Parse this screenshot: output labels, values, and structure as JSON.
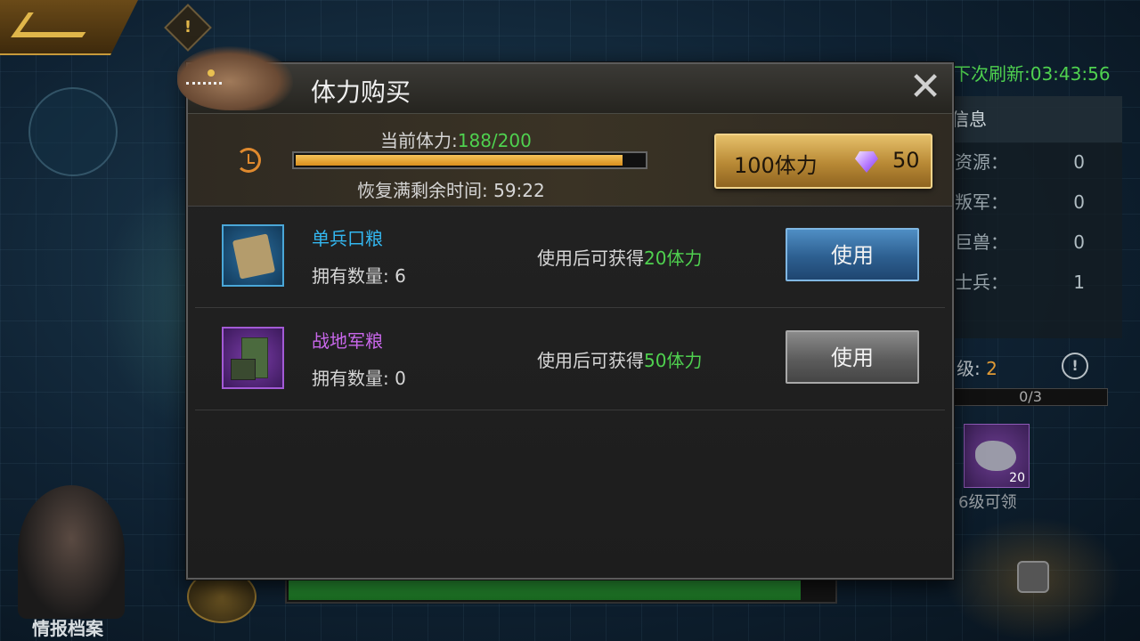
{
  "background": {
    "refresh_timer": "下次刷新:03:43:56",
    "panel_head": "信息",
    "rows": [
      {
        "label": "资源：",
        "value": "0"
      },
      {
        "label": "叛军：",
        "value": "0"
      },
      {
        "label": "巨兽：",
        "value": "0"
      },
      {
        "label": "士兵：",
        "value": "1"
      }
    ],
    "level_label": "级:",
    "level_value": "2",
    "progress": "0/3",
    "reward_count": "20",
    "reward_label": "6级可领",
    "portrait_label": "情报档案",
    "bottom_progress_fraction": 0.94
  },
  "dialog": {
    "title": "体力购买",
    "close_icon": "close-icon",
    "stamina": {
      "current_label": "当前体力:",
      "current_value": "188/200",
      "bar_fraction": 0.94,
      "recover_text": "恢复满剩余时间: 59:22"
    },
    "buy": {
      "label": "100体力",
      "cost": "50",
      "currency_icon": "diamond-icon"
    },
    "items": [
      {
        "name": "单兵口粮",
        "rarity_color": "#33b7f0",
        "count_text": "拥有数量: 6",
        "desc_prefix": "使用后可获得",
        "desc_gain": "20体力",
        "button_label": "使用",
        "button_style": "blue",
        "icon": "ration-pack-icon"
      },
      {
        "name": "战地军粮",
        "rarity_color": "#c867ea",
        "count_text": "拥有数量: 0",
        "desc_prefix": "使用后可获得",
        "desc_gain": "50体力",
        "button_label": "使用",
        "button_style": "gray",
        "icon": "field-ration-box-icon"
      }
    ]
  },
  "colors": {
    "accent_green": "#4fd14f",
    "gold": "#e6c06a",
    "blue_rarity": "#33b7f0",
    "purple_rarity": "#c867ea"
  }
}
